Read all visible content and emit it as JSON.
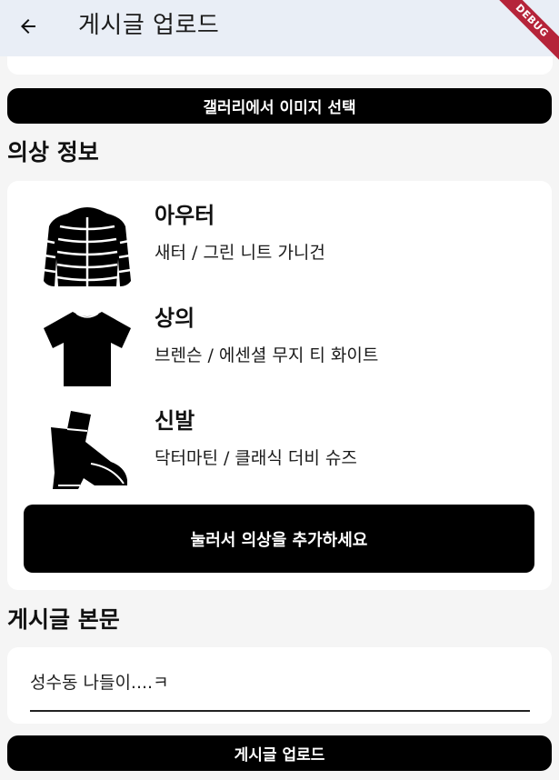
{
  "appbar": {
    "title": "게시글 업로드",
    "debug_banner": "DEBUG",
    "back_icon": "arrow-left-icon"
  },
  "gallery_button": "갤러리에서 이미지 선택",
  "clothing_section": {
    "title": "의상 정보",
    "items": [
      {
        "category": "아우터",
        "detail": "새터 / 그린 니트 가니건",
        "icon": "puffer-jacket-icon"
      },
      {
        "category": "상의",
        "detail": "브렌슨 / 에센셜 무지 티 화이트",
        "icon": "tshirt-icon"
      },
      {
        "category": "신발",
        "detail": "닥터마틴 / 클래식 더비 슈즈",
        "icon": "boots-icon"
      }
    ],
    "add_button": "눌러서 의상을 추가하세요"
  },
  "body_section": {
    "title": "게시글 본문",
    "input_value": "성수동 나들이....ㅋ"
  },
  "upload_button": "게시글 업로드",
  "colors": {
    "appbar_bg": "#e9eef6",
    "page_bg": "#f5f5f5",
    "button_bg": "#000000",
    "debug_banner": "#b5243a"
  }
}
